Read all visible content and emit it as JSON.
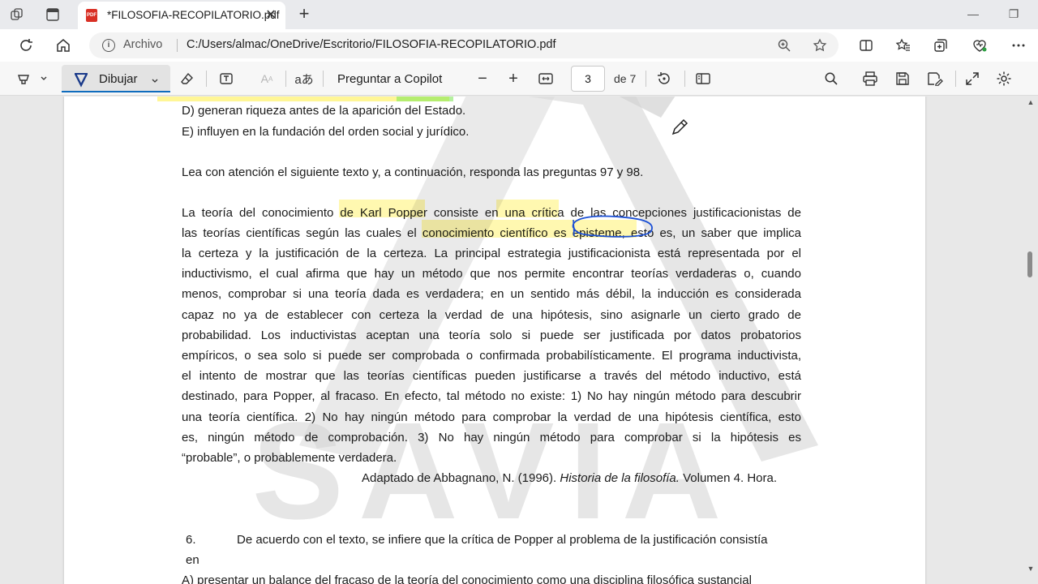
{
  "tab": {
    "title": "*FILOSOFIA-RECOPILATORIO.pdf",
    "favicon": "PDF"
  },
  "address": {
    "scheme_label": "Archivo",
    "url": "C:/Users/almac/OneDrive/Escritorio/FILOSOFIA-RECOPILATORIO.pdf"
  },
  "toolbar": {
    "draw_label": "Dibujar",
    "copilot_label": "Preguntar a Copilot",
    "current_page": "3",
    "total_pages": "de 7"
  },
  "document": {
    "option_d": "D) generan riqueza antes de la aparición del Estado.",
    "option_e": "E) influyen en la fundación del orden social y jurídico.",
    "instruction": "Lea con atención el siguiente texto y, a continuación, responda las preguntas 97 y 98.",
    "paragraph_lines": [
      "La teoría del conocimiento de Karl Popper consiste en una crítica de las concepciones justificacionistas de",
      "las teorías científicas según las cuales el conocimiento científico es episteme, esto es, un saber que implica",
      "la certeza y la justificación de la certeza. La principal estrategia justificacionista está representada por el",
      "inductivismo, el cual afirma que hay un método que nos permite encontrar teorías verdaderas o, cuando",
      "menos, comprobar si una teoría dada es verdadera; en un sentido más débil, la inducción es considerada",
      "capaz no ya de establecer con certeza la verdad de una hipótesis, sino asignarle un cierto grado de",
      "probabilidad. Los inductivistas aceptan una teoría solo si puede ser justificada por datos probatorios",
      "empíricos, o sea solo si puede ser comprobada o confirmada probabilísticamente. El programa inductivista,",
      "el intento de mostrar que las teorías científicas pueden justificarse a través del método inductivo, está",
      "destinado, para Popper, al fracaso.  En efecto, tal método no existe: 1) No hay ningún método para descubrir",
      "una teoría científica. 2) No hay ningún método para comprobar la verdad de una hipótesis científica, esto",
      "es, ningún método de comprobación. 3) No hay ningún método para comprobar si la hipótesis es"
    ],
    "last_line": "“probable”, o probablemente verdadera.",
    "citation_prefix": "Adaptado de Abbagnano, N. (1996). ",
    "citation_title": "Historia de la filosofía.",
    "citation_suffix": " Volumen 4. Hora.",
    "question_number": "6.",
    "question_text": "De acuerdo con el texto, se infiere que la crítica de Popper al problema de la justificación consistía",
    "question_continuation": "en",
    "cut_off_line": "A) presentar un balance del fracaso de la teoría del conocimiento como una disciplina filosófica sustancial",
    "watermark_text": "SAVIA"
  },
  "colors": {
    "accent": "#0f6cbd",
    "highlight": "#fff050",
    "ink": "#1a4fd6"
  }
}
